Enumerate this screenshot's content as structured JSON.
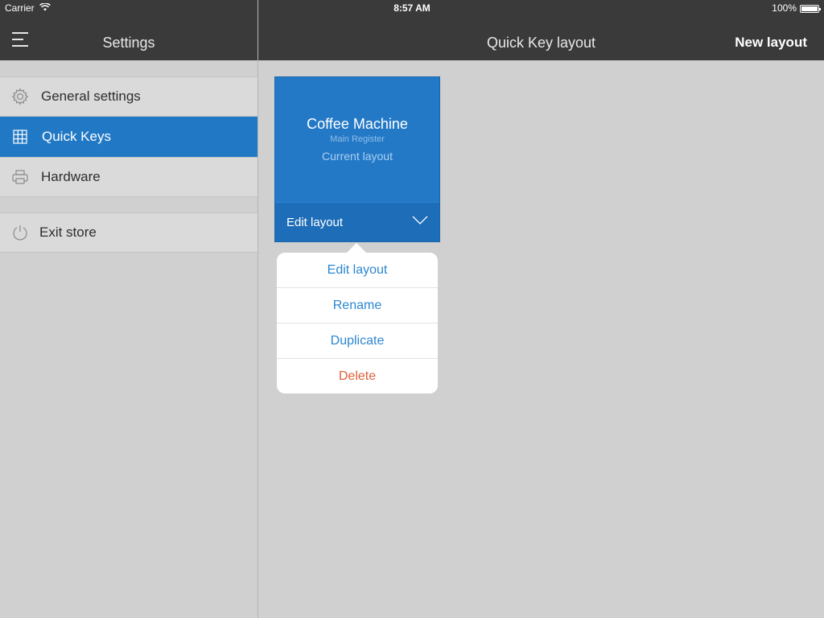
{
  "status": {
    "carrier": "Carrier",
    "time": "8:57 AM",
    "battery": "100%"
  },
  "nav": {
    "sidebar_title": "Settings",
    "main_title": "Quick Key layout",
    "action": "New layout"
  },
  "sidebar": {
    "items": [
      {
        "label": "General settings",
        "icon": "gear-icon"
      },
      {
        "label": "Quick Keys",
        "icon": "grid-icon",
        "active": true
      },
      {
        "label": "Hardware",
        "icon": "printer-icon"
      },
      {
        "label": "Exit store",
        "icon": "power-icon"
      }
    ]
  },
  "card": {
    "title": "Coffee Machine",
    "subtitle": "Main Register",
    "status": "Current layout",
    "footer_label": "Edit layout"
  },
  "popover": {
    "items": [
      {
        "label": "Edit layout"
      },
      {
        "label": "Rename"
      },
      {
        "label": "Duplicate"
      },
      {
        "label": "Delete",
        "destructive": true
      }
    ]
  },
  "colors": {
    "topbar": "#3a3a3a",
    "accent": "#2179c6",
    "background": "#d0d0d0",
    "destructive": "#e0603a",
    "link": "#2b86cf"
  }
}
